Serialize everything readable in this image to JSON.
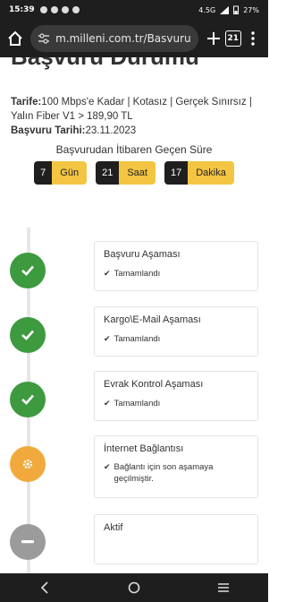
{
  "status_bar": {
    "time": "15:39",
    "network": "4.5G",
    "battery": "27%"
  },
  "browser": {
    "url": "m.milleni.com.tr/Basvuru",
    "tab_count": "21"
  },
  "page": {
    "heading": "Başvuru Durumu",
    "tariff_label": "Tarife:",
    "tariff_value": "100 Mbps'e Kadar | Kotasız | Gerçek Sınırsız | Yalın Fiber V1 > 189,90 TL",
    "date_label": "Başvuru Tarihi:",
    "date_value": "23.11.2023",
    "elapsed_title": "Başvurudan İtibaren Geçen Süre",
    "timers": [
      {
        "value": "7",
        "unit": "Gün"
      },
      {
        "value": "21",
        "unit": "Saat"
      },
      {
        "value": "17",
        "unit": "Dakika"
      }
    ]
  },
  "steps": [
    {
      "title": "Başvuru Aşaması",
      "status": "Tamamlandı",
      "state": "done",
      "icon": "check-icon"
    },
    {
      "title": "Kargo\\E-Mail Aşaması",
      "status": "Tamamlandı",
      "state": "done",
      "icon": "check-icon"
    },
    {
      "title": "Evrak Kontrol Aşaması",
      "status": "Tamamlandı",
      "state": "done",
      "icon": "check-icon"
    },
    {
      "title": "İnternet Bağlantısı",
      "status": "Bağlantı için son aşamaya geçilmiştir.",
      "state": "in-progress",
      "icon": "gear-icon"
    },
    {
      "title": "Aktif",
      "status": "",
      "state": "pending",
      "icon": "minus-icon"
    }
  ],
  "colors": {
    "done": "#3d9a3f",
    "in_progress": "#f2a93b",
    "pending": "#9b9b9b",
    "timer_unit_bg": "#f4c542",
    "timer_num_bg": "#1f1f1f"
  }
}
